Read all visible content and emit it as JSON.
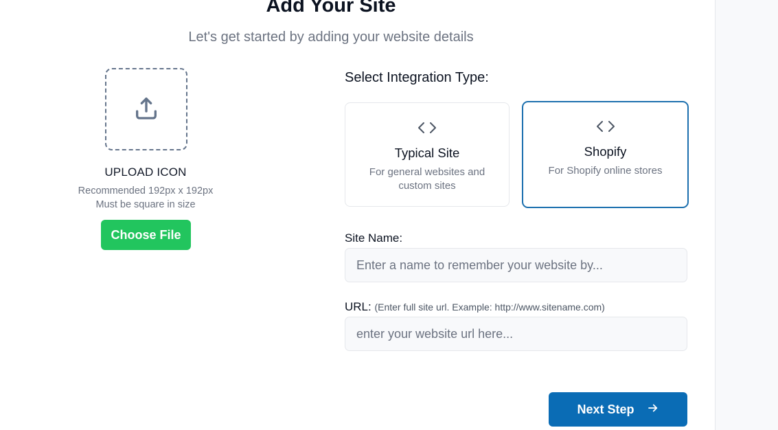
{
  "header": {
    "title": "Add Your Site",
    "subtitle": "Let's get started by adding your website details"
  },
  "upload": {
    "icon": "upload-icon",
    "title": "UPLOAD ICON",
    "hint_line1": "Recommended 192px x 192px",
    "hint_line2": "Must be square in size",
    "button_label": "Choose File"
  },
  "integration": {
    "label": "Select Integration Type:",
    "options": [
      {
        "icon": "code-icon",
        "title": "Typical Site",
        "description": "For general websites and custom sites",
        "selected": false
      },
      {
        "icon": "code-icon",
        "title": "Shopify",
        "description": "For Shopify online stores",
        "selected": true
      }
    ],
    "selected_color": "#1b6fae"
  },
  "form": {
    "site_name_label": "Site Name:",
    "site_name_placeholder": "Enter a name to remember your website by...",
    "site_name_value": "",
    "url_label": "URL:",
    "url_hint": "(Enter full site url. Example: http://www.sitename.com)",
    "url_placeholder": "enter your website url here...",
    "url_value": ""
  },
  "actions": {
    "next_label": "Next Step",
    "next_icon": "arrow-right-icon",
    "next_color": "#0a6cb5",
    "choose_color": "#22c55e"
  }
}
